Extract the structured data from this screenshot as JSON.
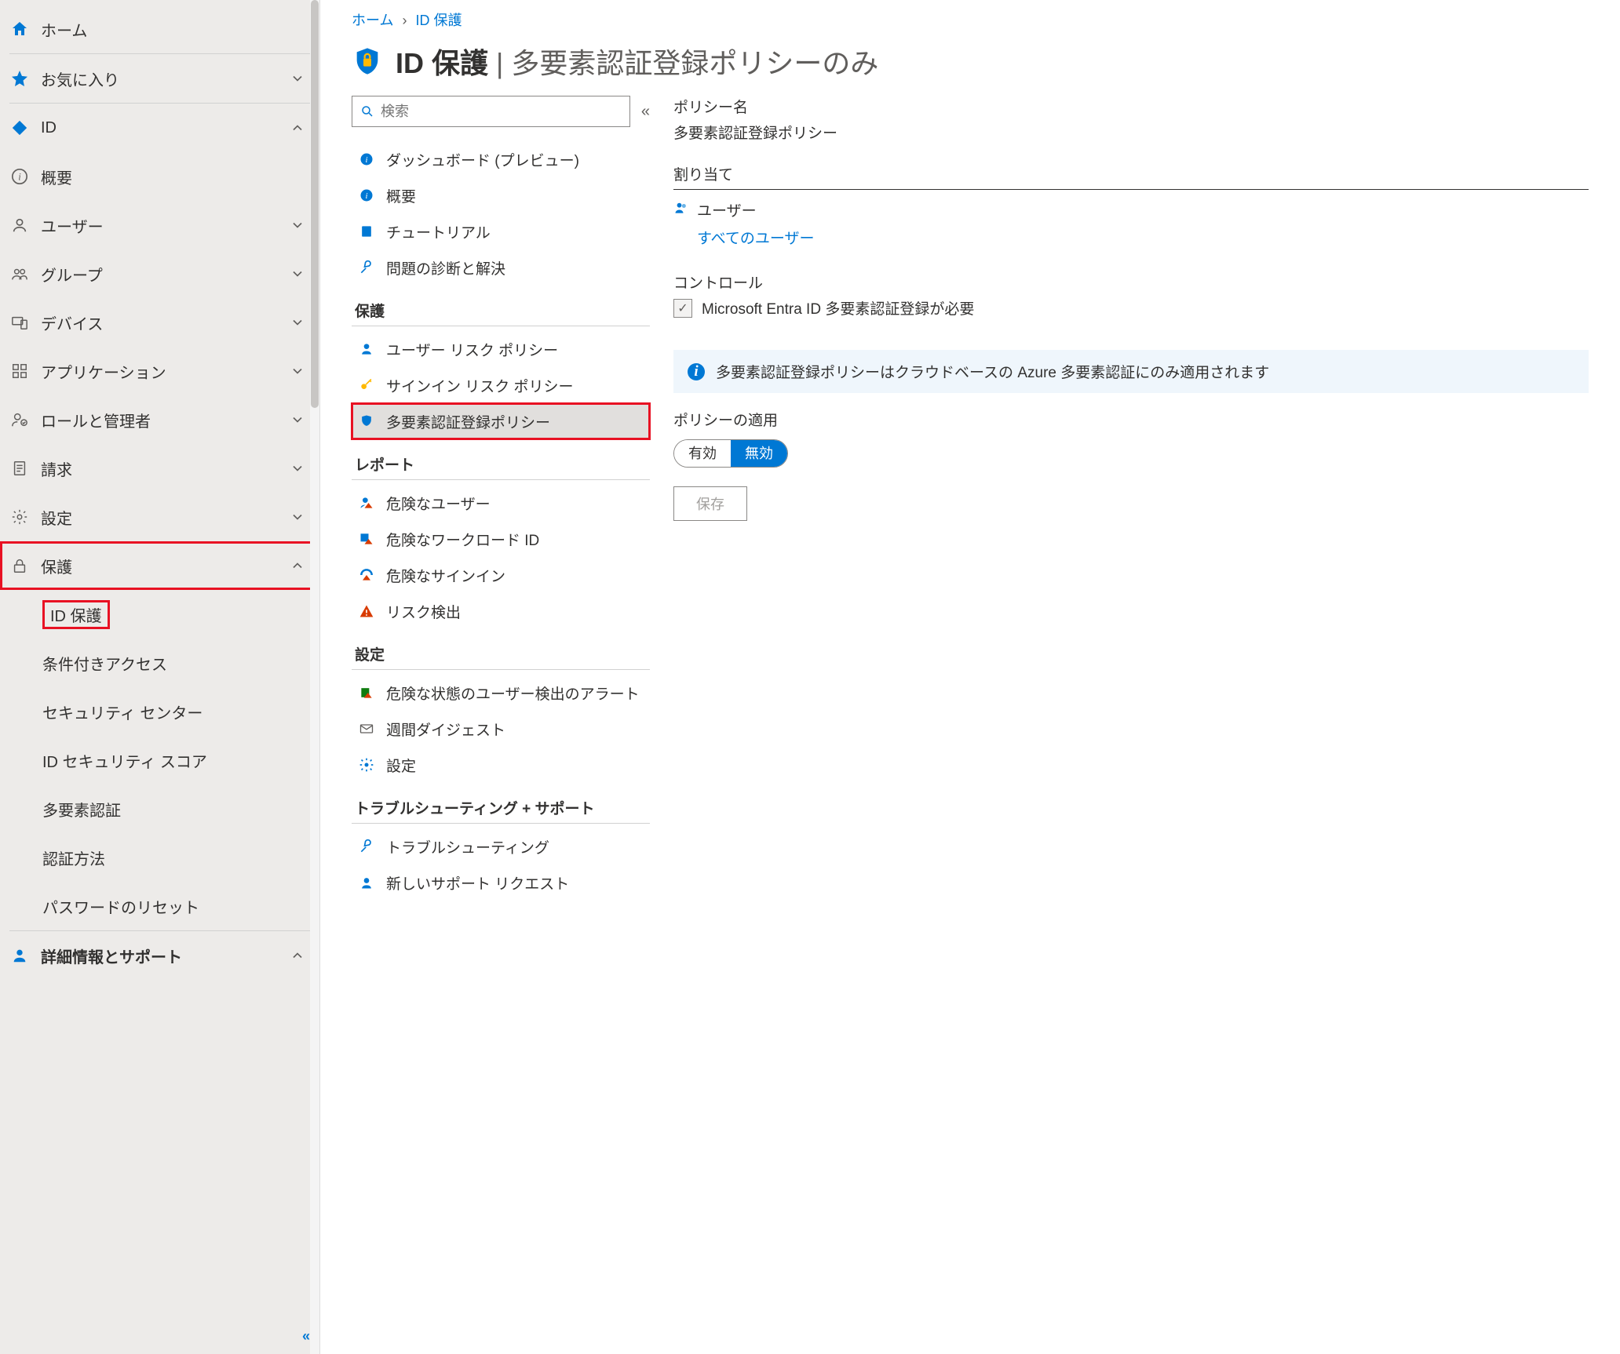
{
  "breadcrumb": {
    "home": "ホーム",
    "current": "ID 保護"
  },
  "blade": {
    "title_main": "ID 保護",
    "title_sep": " | ",
    "title_sub": "多要素認証登録ポリシーのみ"
  },
  "sidebar": {
    "home": "ホーム",
    "favorites": "お気に入り",
    "id": "ID",
    "overview": "概要",
    "users": "ユーザー",
    "groups": "グループ",
    "devices": "デバイス",
    "applications": "アプリケーション",
    "roles_admins": "ロールと管理者",
    "billing": "請求",
    "settings": "設定",
    "protection": "保護",
    "id_protection": "ID 保護",
    "conditional_access": "条件付きアクセス",
    "security_center": "セキュリティ センター",
    "id_security_score": "ID セキュリティ スコア",
    "mfa": "多要素認証",
    "auth_methods": "認証方法",
    "password_reset": "パスワードのリセット",
    "more_info_support": "詳細情報とサポート"
  },
  "resource_menu": {
    "search_placeholder": "検索",
    "dashboard": "ダッシュボード (プレビュー)",
    "overview": "概要",
    "tutorial": "チュートリアル",
    "diagnose": "問題の診断と解決",
    "grp_protect": "保護",
    "user_risk_policy": "ユーザー リスク ポリシー",
    "signin_risk_policy": "サインイン リスク ポリシー",
    "mfa_reg_policy": "多要素認証登録ポリシー",
    "grp_report": "レポート",
    "risky_users": "危険なユーザー",
    "risky_workload_id": "危険なワークロード ID",
    "risky_signins": "危険なサインイン",
    "risk_detections": "リスク検出",
    "grp_settings": "設定",
    "risky_user_alerts": "危険な状態のユーザー検出のアラート",
    "weekly_digest": "週間ダイジェスト",
    "settings": "設定",
    "grp_support": "トラブルシューティング + サポート",
    "troubleshooting": "トラブルシューティング",
    "new_support_request": "新しいサポート リクエスト"
  },
  "content": {
    "policy_name_label": "ポリシー名",
    "policy_name_value": "多要素認証登録ポリシー",
    "assignments_label": "割り当て",
    "users_label": "ユーザー",
    "all_users": "すべてのユーザー",
    "controls_label": "コントロール",
    "controls_value": "Microsoft Entra ID 多要素認証登録が必要",
    "banner": "多要素認証登録ポリシーはクラウドベースの Azure 多要素認証にのみ適用されます",
    "apply_label": "ポリシーの適用",
    "enable": "有効",
    "disable": "無効",
    "save": "保存"
  }
}
